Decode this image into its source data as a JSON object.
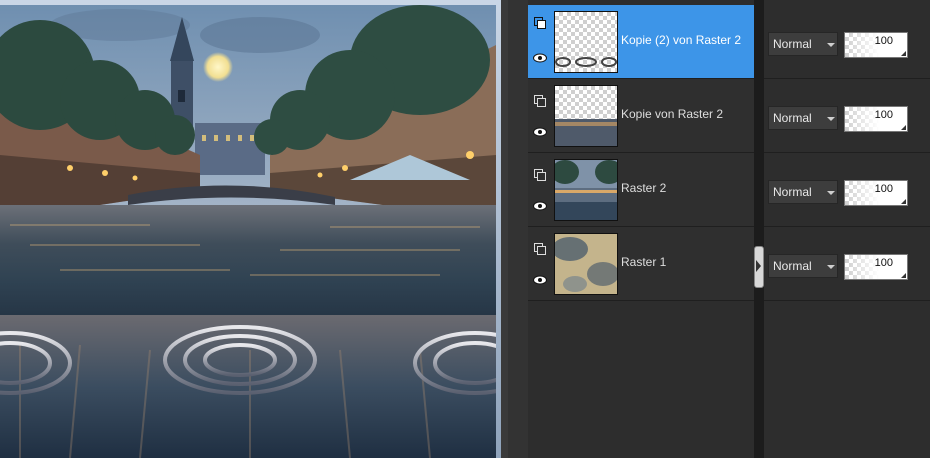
{
  "canvas": {
    "icon": "city-canal-night-image"
  },
  "layers": [
    {
      "name": "Kopie (2) von Raster 2",
      "blend": "Normal",
      "opacity": "100",
      "selected": true,
      "thumb": "rings-thumb"
    },
    {
      "name": "Kopie von Raster 2",
      "blend": "Normal",
      "opacity": "100",
      "selected": false,
      "thumb": "strip-thumb"
    },
    {
      "name": "Raster 2",
      "blend": "Normal",
      "opacity": "100",
      "selected": false,
      "thumb": "scene-thumb"
    },
    {
      "name": "Raster 1",
      "blend": "Normal",
      "opacity": "100",
      "selected": false,
      "thumb": "clouds-thumb"
    }
  ],
  "colors": {
    "selection": "#3d95e8",
    "panel": "#2d2d2d"
  }
}
